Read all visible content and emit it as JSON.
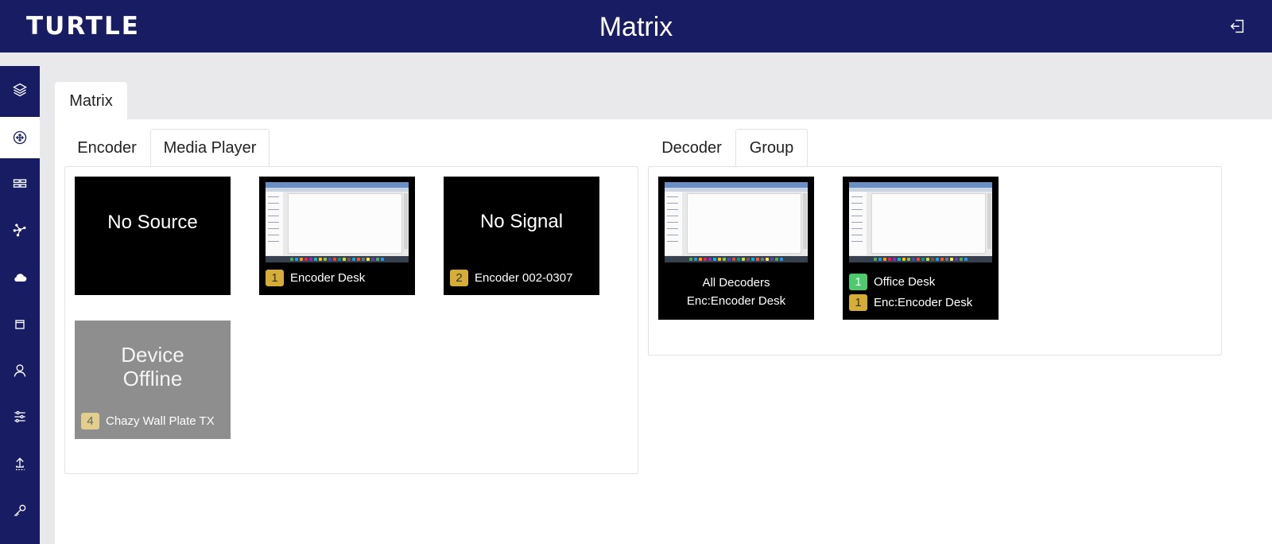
{
  "header": {
    "logo": "TURTLE",
    "title": "Matrix",
    "logout_icon": "logout-icon",
    "background": "#181c63"
  },
  "sidebar": {
    "items": [
      {
        "icon": "layers-icon",
        "active": false
      },
      {
        "icon": "move-icon",
        "active": true
      },
      {
        "icon": "grid-icon",
        "active": false
      },
      {
        "icon": "network-icon",
        "active": false
      },
      {
        "icon": "cloud-icon",
        "active": false
      },
      {
        "icon": "calendar-icon",
        "active": false
      },
      {
        "icon": "user-icon",
        "active": false
      },
      {
        "icon": "sliders-icon",
        "active": false
      },
      {
        "icon": "upload-icon",
        "active": false
      },
      {
        "icon": "key-icon",
        "active": false
      }
    ]
  },
  "main": {
    "tab": "Matrix",
    "left_tabs": [
      "Encoder",
      "Media Player"
    ],
    "right_tabs": [
      "Decoder",
      "Group"
    ],
    "encoders": [
      {
        "big_text": "No Source"
      },
      {
        "badge": "1",
        "label": "Encoder Desk"
      },
      {
        "big_text": "No Signal",
        "badge": "2",
        "label": "Encoder 002-0307"
      },
      {
        "big_text_line1": "Device",
        "big_text_line2": "Offline",
        "badge": "4",
        "label": "Chazy Wall Plate TX"
      }
    ],
    "decoders": [
      {
        "line1": "All Decoders",
        "line2": "Enc:Encoder Desk"
      },
      {
        "badge1": "1",
        "label1": "Office Desk",
        "badge2": "1",
        "label2": "Enc:Encoder Desk"
      }
    ]
  },
  "colors": {
    "gold_badge": "#d6ad37",
    "green_badge": "#4ec96d",
    "offline_tile": "#8e8e8e"
  }
}
